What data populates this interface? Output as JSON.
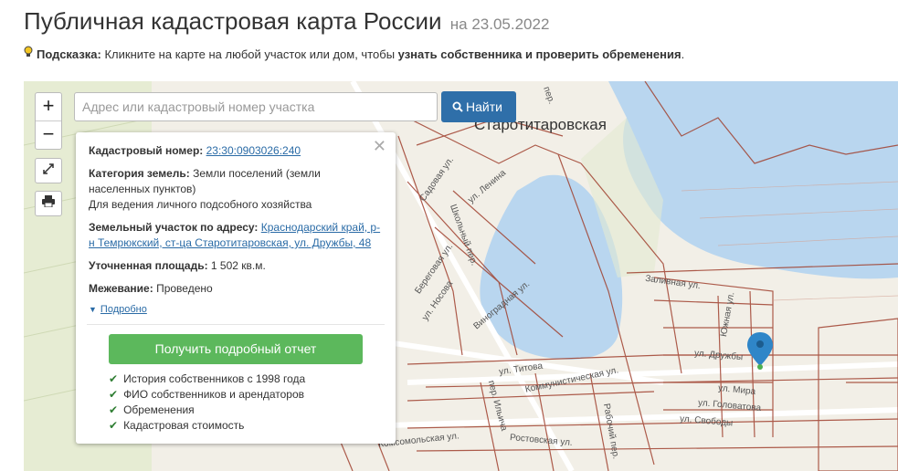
{
  "header": {
    "title": "Публичная кадастровая карта России",
    "date": "на 23.05.2022"
  },
  "hint": {
    "label": "Подсказка:",
    "text_before": " Кликните на карте на любой участок или дом, чтобы ",
    "text_bold": "узнать собственника и проверить обременения",
    "text_after": "."
  },
  "map": {
    "zoom_in": "+",
    "zoom_out": "−",
    "fullscreen_icon": "expand-icon",
    "print_icon": "printer-icon",
    "search": {
      "placeholder": "Адрес или кадастровый номер участка",
      "button": "Найти"
    },
    "town": "Старотитаровская",
    "labels": [
      {
        "text": "Садовая ул.",
        "name": "label-sadovaya"
      },
      {
        "text": "ул. Ленина",
        "name": "label-lenina"
      },
      {
        "text": "Школьный пер.",
        "name": "label-shkolny"
      },
      {
        "text": "Береговая ул.",
        "name": "label-beregovaya"
      },
      {
        "text": "ул. Носова",
        "name": "label-nosova"
      },
      {
        "text": "Виноградная ул.",
        "name": "label-vinogradnaya"
      },
      {
        "text": "Заливная ул.",
        "name": "label-zalivnaya"
      },
      {
        "text": "Южная ул.",
        "name": "label-yuzhnaya"
      },
      {
        "text": "ул. Дружбы",
        "name": "label-druzhby"
      },
      {
        "text": "ул. Мира",
        "name": "label-mira"
      },
      {
        "text": "ул. Головатова",
        "name": "label-golovatova"
      },
      {
        "text": "ул. Свободы",
        "name": "label-svobody"
      },
      {
        "text": "ул. Титова",
        "name": "label-titova"
      },
      {
        "text": "Коммунистическая ул.",
        "name": "label-kommunisticheskaya"
      },
      {
        "text": "пер. Ильича",
        "name": "label-ilicha"
      },
      {
        "text": "Ростовская ул.",
        "name": "label-rostovskaya"
      },
      {
        "text": "Комсомольская ул.",
        "name": "label-komsomolskaya"
      },
      {
        "text": "Рабочий пер.",
        "name": "label-rabochy"
      },
      {
        "text": "пер.",
        "name": "label-per"
      }
    ],
    "colors": {
      "water": "#b9d6ef",
      "land": "#f2efe7",
      "green": "#e4ebd1",
      "parcel_border": "#a0412f",
      "marker": "#2f86c8"
    }
  },
  "info": {
    "cadastral_label": "Кадастровый номер:",
    "cadastral_value": "23:30:0903026:240",
    "category_label": "Категория земель:",
    "category_value": " Земли поселений (земли населенных пунктов)",
    "usage": "Для ведения личного подсобного хозяйства",
    "address_label": "Земельный участок по адресу:",
    "address_value": "Краснодарский край, р-н Темрюкский, ст-ца Старотитаровская, ул. Дружбы, 48",
    "area_label": "Уточненная площадь:",
    "area_value": " 1 502 кв.м.",
    "survey_label": "Межевание:",
    "survey_value": " Проведено",
    "more_link": "Подробно",
    "close": "✕",
    "report_button": "Получить подробный отчет",
    "features": [
      "История собственников с 1998 года",
      "ФИО собственников и арендаторов",
      "Обременения",
      "Кадастровая стоимость"
    ]
  }
}
